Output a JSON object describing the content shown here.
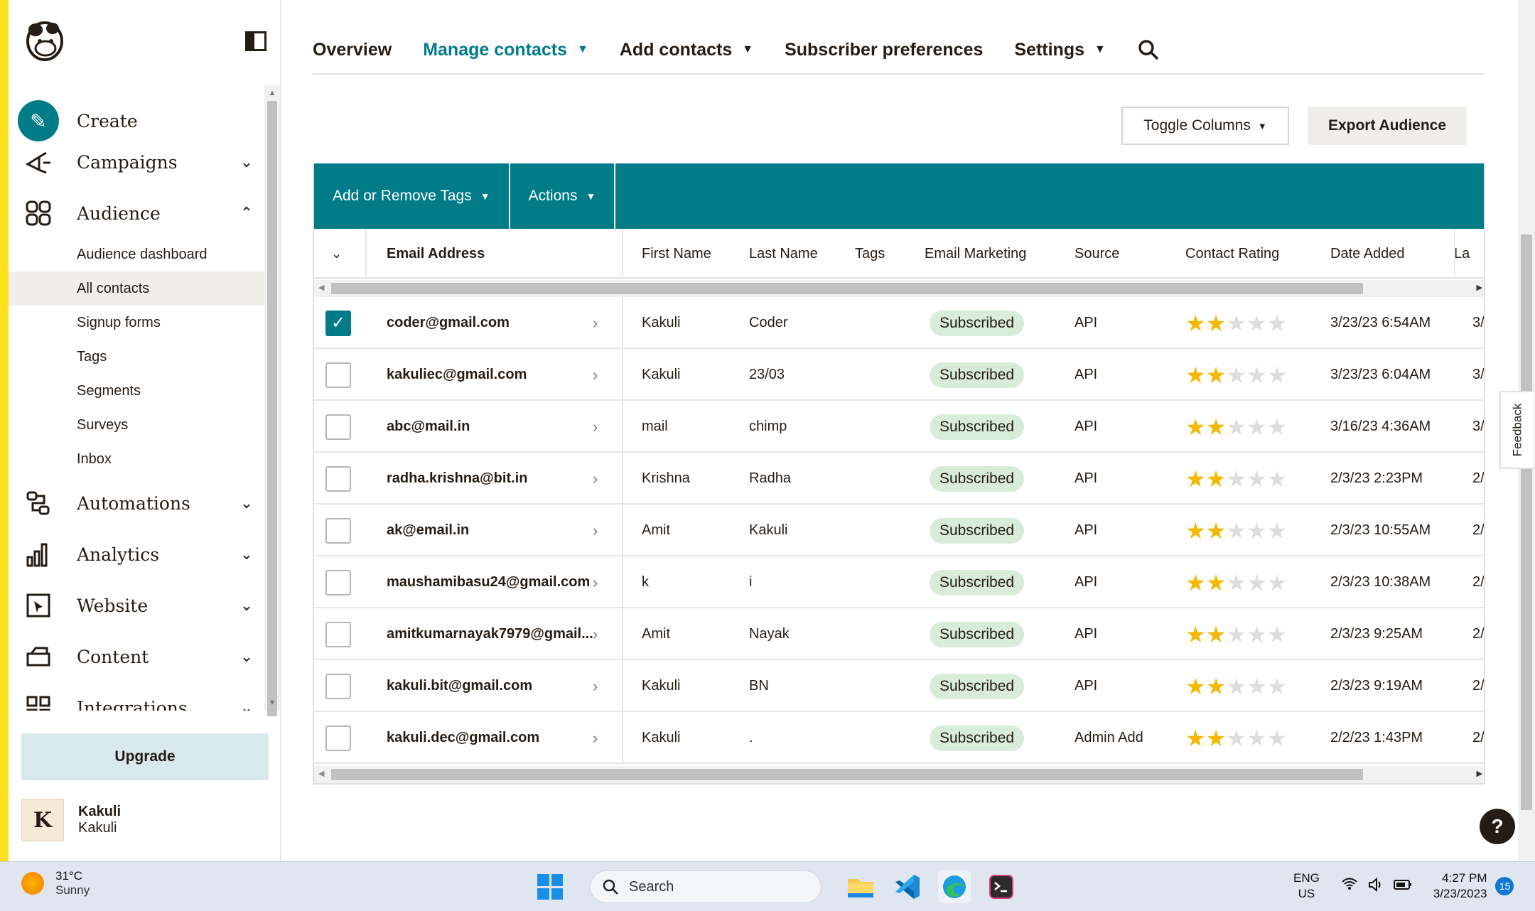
{
  "sidebar": {
    "nav": [
      {
        "label": "Create",
        "icon": "pencil-icon"
      },
      {
        "label": "Campaigns",
        "icon": "megaphone-icon"
      },
      {
        "label": "Audience",
        "icon": "audience-icon"
      },
      {
        "label": "Automations",
        "icon": "automations-icon"
      },
      {
        "label": "Analytics",
        "icon": "bar-chart-icon"
      },
      {
        "label": "Website",
        "icon": "website-icon"
      },
      {
        "label": "Content",
        "icon": "content-icon"
      },
      {
        "label": "Integrations",
        "icon": "integrations-icon"
      }
    ],
    "audience_sub": [
      "Audience dashboard",
      "All contacts",
      "Signup forms",
      "Tags",
      "Segments",
      "Surveys",
      "Inbox"
    ],
    "upgrade": "Upgrade",
    "user": {
      "initial": "K",
      "name": "Kakuli",
      "org": "Kakuli"
    }
  },
  "topnav": {
    "tabs": [
      "Overview",
      "Manage contacts",
      "Add contacts",
      "Subscriber preferences",
      "Settings"
    ]
  },
  "toolbar": {
    "toggle_columns": "Toggle Columns",
    "export": "Export Audience",
    "tags": "Add or Remove Tags",
    "actions": "Actions"
  },
  "table": {
    "headers": [
      "Email Address",
      "First Name",
      "Last Name",
      "Tags",
      "Email Marketing",
      "Source",
      "Contact Rating",
      "Date Added",
      "La"
    ],
    "rows": [
      {
        "checked": true,
        "email": "coder@gmail.com",
        "first": "Kakuli",
        "last": "Coder",
        "status": "Subscribed",
        "source": "API",
        "rating": 2,
        "date": "3/23/23 6:54AM",
        "next": "3/"
      },
      {
        "checked": false,
        "email": "kakuliec@gmail.com",
        "first": "Kakuli",
        "last": "23/03",
        "status": "Subscribed",
        "source": "API",
        "rating": 2,
        "date": "3/23/23 6:04AM",
        "next": "3/"
      },
      {
        "checked": false,
        "email": "abc@mail.in",
        "first": "mail",
        "last": "chimp",
        "status": "Subscribed",
        "source": "API",
        "rating": 2,
        "date": "3/16/23 4:36AM",
        "next": "3/"
      },
      {
        "checked": false,
        "email": "radha.krishna@bit.in",
        "first": "Krishna",
        "last": "Radha",
        "status": "Subscribed",
        "source": "API",
        "rating": 2,
        "date": "2/3/23 2:23PM",
        "next": "2/"
      },
      {
        "checked": false,
        "email": "ak@email.in",
        "first": "Amit",
        "last": "Kakuli",
        "status": "Subscribed",
        "source": "API",
        "rating": 2,
        "date": "2/3/23 10:55AM",
        "next": "2/"
      },
      {
        "checked": false,
        "email": "maushamibasu24@gmail.com",
        "first": "k",
        "last": "i",
        "status": "Subscribed",
        "source": "API",
        "rating": 2,
        "date": "2/3/23 10:38AM",
        "next": "2/"
      },
      {
        "checked": false,
        "email": "amitkumarnayak7979@gmail...",
        "first": "Amit",
        "last": "Nayak",
        "status": "Subscribed",
        "source": "API",
        "rating": 2,
        "date": "2/3/23 9:25AM",
        "next": "2/"
      },
      {
        "checked": false,
        "email": "kakuli.bit@gmail.com",
        "first": "Kakuli",
        "last": "BN",
        "status": "Subscribed",
        "source": "API",
        "rating": 2,
        "date": "2/3/23 9:19AM",
        "next": "2/"
      },
      {
        "checked": false,
        "email": "kakuli.dec@gmail.com",
        "first": "Kakuli",
        "last": ".",
        "status": "Subscribed",
        "source": "Admin Add",
        "rating": 2,
        "date": "2/2/23 1:43PM",
        "next": "2/"
      }
    ]
  },
  "feedback": "Feedback",
  "help": "?",
  "taskbar": {
    "temp": "31°C",
    "weather": "Sunny",
    "search": "Search",
    "lang1": "ENG",
    "lang2": "US",
    "time": "4:27 PM",
    "date": "3/23/2023",
    "notifications": "15"
  },
  "colors": {
    "accent": "#007c89",
    "brand_yellow": "#ffe01b",
    "badge": "#d7ecd9",
    "star": "#f5b800"
  }
}
